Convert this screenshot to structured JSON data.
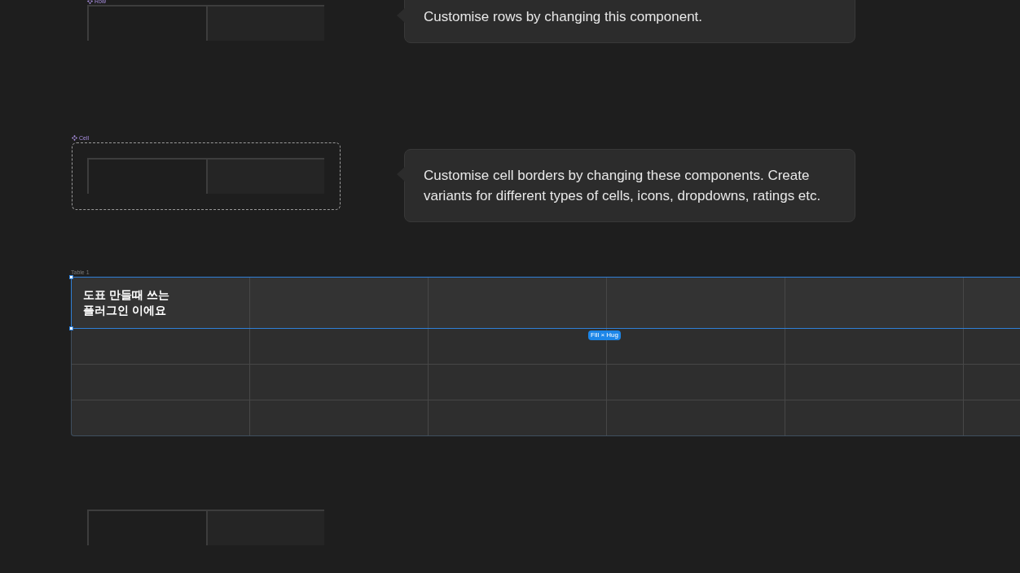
{
  "components": [
    {
      "kind": "row",
      "label": "Row"
    },
    {
      "kind": "cell",
      "label": "Cell"
    }
  ],
  "notes": [
    {
      "text": "Customise rows by changing this component."
    },
    {
      "text": "Customise cell borders by changing these components. Create variants for different types of cells, icons, dropdowns, ratings etc."
    }
  ],
  "table": {
    "label": "Table 1",
    "header": {
      "text": "도표 만들때 쓰는\n플러그인 이에요",
      "selected": true
    },
    "size_badge": "Fill × Hug"
  }
}
